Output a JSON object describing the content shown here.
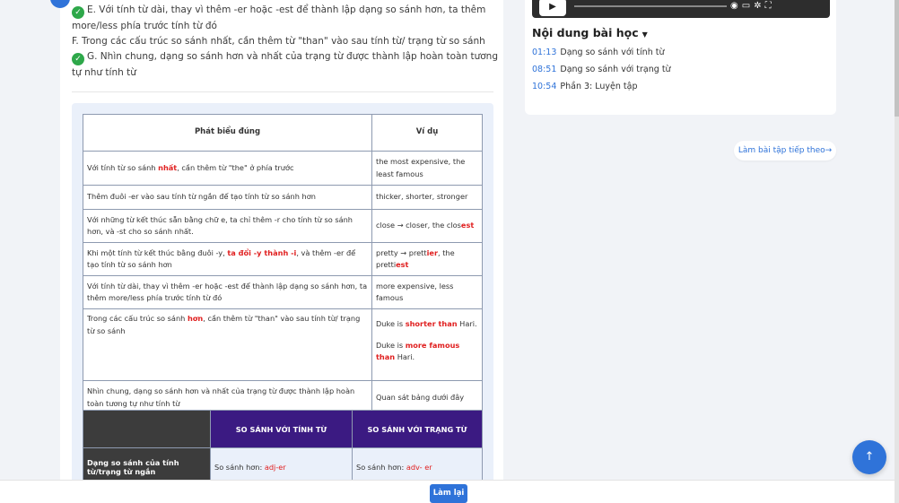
{
  "statements": [
    {
      "checked": true,
      "text": "E. Với tính từ dài, thay vì thêm -er hoặc -est để thành lập dạng so sánh hơn, ta thêm more/less phía trước tính từ đó"
    },
    {
      "checked": false,
      "text": "F. Trong các cấu trúc so sánh nhất, cần thêm từ \"than\" vào sau tính từ/ trạng từ so sánh"
    },
    {
      "checked": true,
      "text": "G. Nhìn chung, dạng so sánh hơn và nhất của trạng từ được thành lập hoàn toàn tương tự như tính từ"
    }
  ],
  "rules_table": {
    "headers": [
      "Phát biểu đúng",
      "Ví dụ"
    ],
    "rows": [
      {
        "a1": "Với tính từ so sánh ",
        "ahl": "nhất",
        "a2": ", cần thêm từ \"the\" ở phía trước",
        "ex": "the most expensive, the least famous"
      },
      {
        "a1": "Thêm đuôi -er vào sau tính từ ngắn để tạo tính từ so sánh hơn",
        "ex": "thicker, shorter, stronger"
      },
      {
        "a1": "Với những từ kết thúc sẵn bằng chữ e, ta chỉ thêm -r cho tính từ so sánh hơn, và -st cho so sánh nhất.",
        "ex1": "close → closer, the clos",
        "exhl": "est"
      },
      {
        "a1": "Khi một tính từ kết thúc bằng đuôi -y, ",
        "ahl": "ta đổi -y thành -i",
        "a2": ", và thêm -er để tạo tính từ so sánh hơn",
        "ex1": "pretty → prett",
        "exhl": "ier",
        "ex2": ", the pretti",
        "exhl2": "est"
      },
      {
        "a1": "Với tính từ dài, thay vì thêm -er hoặc -est để thành lập dạng so sánh hơn, ta thêm more/less phía trước tính từ đó",
        "ex": "more expensive, less famous"
      },
      {
        "a1": "Trong các cấu trúc so sánh ",
        "ahl": "hơn",
        "a2": ", cần thêm từ \"than\" vào sau tính từ/ trạng từ so sánh",
        "exA1": "Duke is ",
        "exAhl": "shorter than",
        "exA2": " Hari.",
        "exB1": "Duke is ",
        "exBhl": "more famous than",
        "exB2": " Hari."
      },
      {
        "a1": "Nhìn chung, dạng so sánh hơn và nhất của trạng từ được thành lập hoàn toàn tương tự như tính từ",
        "ex": "Quan sát bảng dưới đây"
      }
    ]
  },
  "compare_table": {
    "h_adj": "SO SÁNH VỚI TÍNH TỪ",
    "h_adv": "SO SÁNH VỚI TRẠNG TỪ",
    "row_label": "Dạng so sánh của tính từ/trạng từ ngắn",
    "adj_prefix": "So sánh hơn: ",
    "adj_value": "adj-er",
    "adv_prefix": "So sánh hơn: ",
    "adv_value": "adv- er"
  },
  "lesson": {
    "title": "Nội dung bài học",
    "items": [
      {
        "time": "01:13",
        "name": "Dạng so sánh với tính từ"
      },
      {
        "time": "08:51",
        "name": "Dạng so sánh với trạng từ"
      },
      {
        "time": "10:54",
        "name": "Phần 3: Luyện tập"
      }
    ]
  },
  "next_label": "Làm bài tập tiếp theo",
  "retry_label": "Làm lại",
  "icons": {
    "check": "check-circle-icon",
    "play": "play-icon",
    "volume": "volume-icon",
    "scroll_top": "arrow-up-icon",
    "arrow_right": "arrow-right-icon"
  },
  "colors": {
    "accent": "#2f73d9",
    "check": "#2ea84a",
    "highlight": "#e02020",
    "header_purple": "#3b1a82"
  }
}
